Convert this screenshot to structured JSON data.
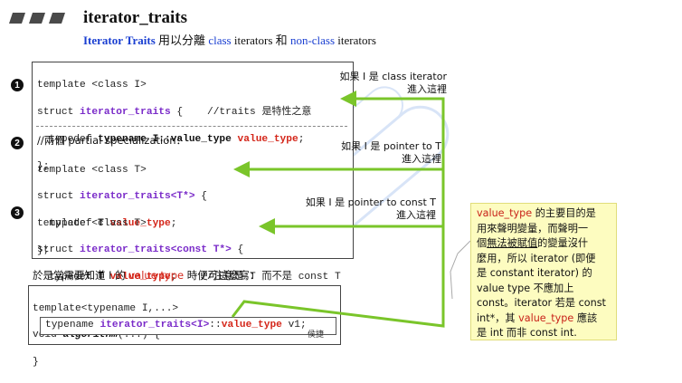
{
  "header": {
    "title": "iterator_traits",
    "subtitle_parts": [
      "Iterator Traits",
      " 用以分離 ",
      "class",
      " iterators 和 ",
      "non-class",
      " iterators"
    ]
  },
  "section1": {
    "number": "1",
    "lines": {
      "l1": "template <class I>",
      "l2_a": "struct ",
      "l2_b": "iterator_traits",
      "l2_c": " {    //traits ",
      "l2_d": "是特性之意",
      "l3_a": "  typedef ",
      "l3_b": "typename I::value_type",
      "l3_c": " value_type",
      "l3_d": ";",
      "l4": "};"
    },
    "note": [
      "如果 I 是 class iterator",
      "進入這裡"
    ]
  },
  "section2": {
    "number": "2",
    "heading": "//兩個 partial specialization：",
    "lines": {
      "l1": "template <class T>",
      "l2_a": "struct ",
      "l2_b": "iterator_traits<T*>",
      "l2_c": " {",
      "l3_a": "  typedef ",
      "l3_b": "T",
      "l3_c": " value_type",
      "l3_d": ";",
      "l4": "};"
    },
    "note": [
      "如果 I 是 pointer to T",
      "進入這裡"
    ]
  },
  "section3": {
    "number": "3",
    "lines": {
      "l1": "template <class T>",
      "l2_a": "struct ",
      "l2_b": "iterator_traits<const T*>",
      "l2_c": " {",
      "l3_a": "  typedef ",
      "l3_b": "T",
      "l3_c": " value_type",
      "l3_d": ";    //注意是 T 而不是 const T",
      "l4": "};"
    },
    "note": [
      "如果 I 是 pointer to const T",
      "進入這裡"
    ]
  },
  "usage": {
    "label_a": "於是當需要知道 I 的 ",
    "label_b": "value type",
    "label_c": " 時便可這麼寫：",
    "lines": {
      "l1": "template<typename I,...>",
      "l2_a": "void ",
      "l2_b": "algorithm",
      "l2_c": "(...) {",
      "l3_a": "typename ",
      "l3_b": "iterator_traits<I>",
      "l3_c": "::",
      "l3_d": "value_type",
      "l3_e": " v1;",
      "l4": "}"
    },
    "box_label": "侯捷"
  },
  "callout": {
    "lines": [
      [
        "value_type",
        " 的主要目的是"
      ],
      [
        "用來聲明變量，而聲明一"
      ],
      [
        "個",
        "無法被賦值",
        "的變量沒什"
      ],
      [
        "麼用，所以 iterator (即便"
      ],
      [
        "是 constant iterator) 的"
      ],
      [
        "value type 不應加上"
      ],
      [
        "const。iterator 若是 const"
      ],
      [
        "int*，其 ",
        "value_type",
        " 應該"
      ],
      [
        "是 int 而非 const int."
      ]
    ]
  },
  "colors": {
    "accent_blue": "#1a3fd1",
    "keyword_purple": "#7a2bc9",
    "value_red": "#d4261a",
    "arrow_green": "#7ac52a",
    "callout_yellow": "#fdfcc0"
  },
  "icons": {
    "header_bars": "header-bars-icon",
    "arrows": "arrow-left-icon"
  }
}
